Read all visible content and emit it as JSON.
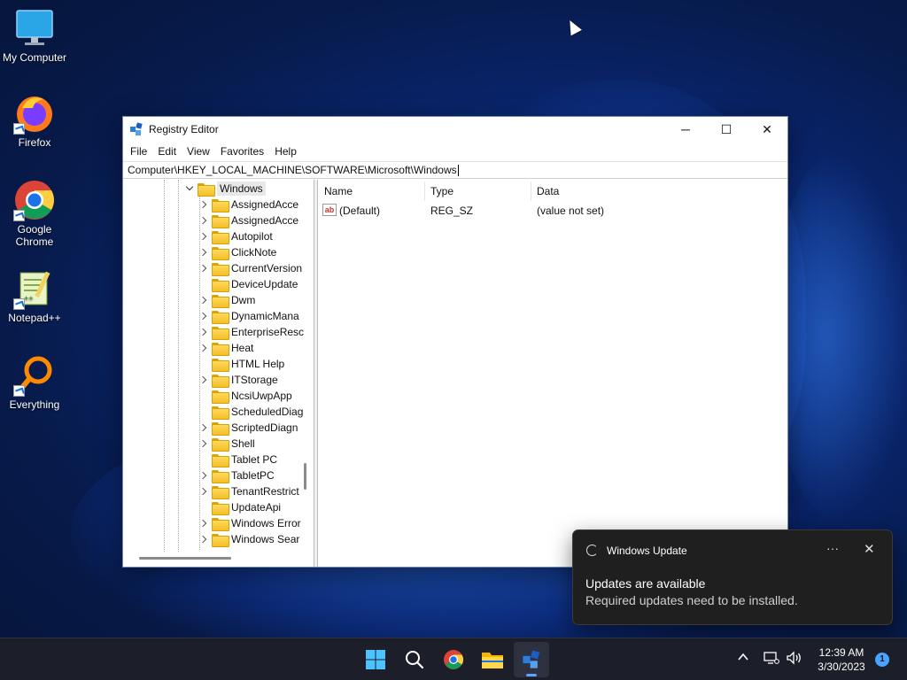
{
  "desktop": {
    "icons": [
      {
        "label": "My Computer",
        "icon": "monitor-icon"
      },
      {
        "label": "Firefox",
        "icon": "firefox-icon"
      },
      {
        "label": "Google\nChrome",
        "label_line1": "Google",
        "label_line2": "Chrome",
        "icon": "chrome-icon"
      },
      {
        "label": "Notepad++",
        "icon": "notepadpp-icon"
      },
      {
        "label": "Everything",
        "icon": "everything-search-icon"
      }
    ]
  },
  "window": {
    "title": "Registry Editor",
    "controls": {
      "minimize": "─",
      "maximize": "☐",
      "close": "✕"
    },
    "menu": [
      "File",
      "Edit",
      "View",
      "Favorites",
      "Help"
    ],
    "address": "Computer\\HKEY_LOCAL_MACHINE\\SOFTWARE\\Microsoft\\Windows",
    "tree": {
      "selected": "Windows",
      "children": [
        {
          "label": "AssignedAcce",
          "expandable": true
        },
        {
          "label": "AssignedAcce",
          "expandable": true
        },
        {
          "label": "Autopilot",
          "expandable": true
        },
        {
          "label": "ClickNote",
          "expandable": true
        },
        {
          "label": "CurrentVersion",
          "expandable": true
        },
        {
          "label": "DeviceUpdate",
          "expandable": false
        },
        {
          "label": "Dwm",
          "expandable": true
        },
        {
          "label": "DynamicMana",
          "expandable": true
        },
        {
          "label": "EnterpriseResc",
          "expandable": true
        },
        {
          "label": "Heat",
          "expandable": true
        },
        {
          "label": "HTML Help",
          "expandable": false
        },
        {
          "label": "ITStorage",
          "expandable": true
        },
        {
          "label": "NcsiUwpApp",
          "expandable": false
        },
        {
          "label": "ScheduledDiag",
          "expandable": false
        },
        {
          "label": "ScriptedDiagn",
          "expandable": true
        },
        {
          "label": "Shell",
          "expandable": true
        },
        {
          "label": "Tablet PC",
          "expandable": false
        },
        {
          "label": "TabletPC",
          "expandable": true
        },
        {
          "label": "TenantRestrict",
          "expandable": true
        },
        {
          "label": "UpdateApi",
          "expandable": false
        },
        {
          "label": "Windows Error",
          "expandable": true
        },
        {
          "label": "Windows Sear",
          "expandable": true
        }
      ]
    },
    "list": {
      "columns": [
        "Name",
        "Type",
        "Data"
      ],
      "rows": [
        {
          "name": "(Default)",
          "type": "REG_SZ",
          "data": "(value not set)",
          "icon_text": "ab"
        }
      ]
    }
  },
  "toast": {
    "app": "Windows Update",
    "more": "···",
    "close": "✕",
    "title": "Updates are available",
    "body": "Required updates need to be installed."
  },
  "taskbar": {
    "apps": [
      "start-icon",
      "search-icon",
      "chrome-icon",
      "file-explorer-icon",
      "registry-editor-icon"
    ],
    "active_app": "registry-editor-icon",
    "clock": {
      "time": "12:39 AM",
      "date": "3/30/2023"
    },
    "notification_count": "1"
  },
  "colors": {
    "accent": "#5aa2ff",
    "taskbar": "#1c1f29",
    "toast_bg": "#1f1f1f"
  }
}
